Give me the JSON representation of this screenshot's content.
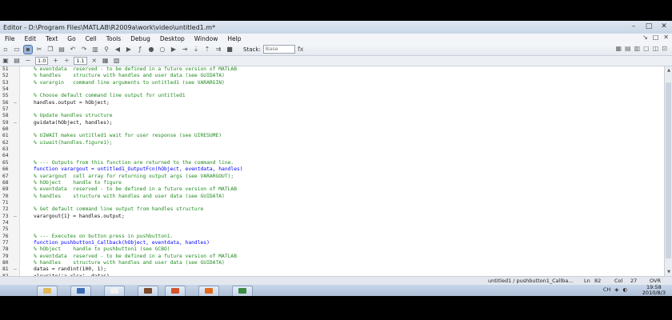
{
  "window": {
    "title": "Editor - D:\\Program Files\\MATLAB\\R2009a\\work\\video\\untitled1.m*",
    "minimize": "–",
    "maximize": "□",
    "close": "✕"
  },
  "menu": {
    "items": [
      "File",
      "Edit",
      "Text",
      "Go",
      "Cell",
      "Tools",
      "Debug",
      "Desktop",
      "Window",
      "Help"
    ],
    "right_controls": [
      "↘",
      "□",
      "✕"
    ]
  },
  "toolbar": {
    "stack_label": "Stack:",
    "stack_value": "Base",
    "fx_label": "fx"
  },
  "cell_toolbar": {
    "minus": "−",
    "value1": "1.0",
    "plus": "+",
    "divide": "÷",
    "value2": "1.1",
    "times": "×"
  },
  "editor": {
    "lines": [
      {
        "n": "51",
        "fold": "",
        "type": "comment",
        "text": "% eventdata  reserved - to be defined in a future version of MATLAB"
      },
      {
        "n": "52",
        "fold": "",
        "type": "comment",
        "text": "% handles    structure with handles and user data (see GUIDATA)"
      },
      {
        "n": "53",
        "fold": "",
        "type": "comment",
        "text": "% varargin   command line arguments to untitled1 (see VARARGIN)"
      },
      {
        "n": "54",
        "fold": "",
        "type": "",
        "text": ""
      },
      {
        "n": "55",
        "fold": "",
        "type": "comment",
        "text": "% Choose default command line output for untitled1"
      },
      {
        "n": "56",
        "fold": "–",
        "type": "",
        "text": "handles.output = hObject;"
      },
      {
        "n": "57",
        "fold": "",
        "type": "",
        "text": ""
      },
      {
        "n": "58",
        "fold": "",
        "type": "comment",
        "text": "% Update handles structure"
      },
      {
        "n": "59",
        "fold": "–",
        "type": "",
        "text": "guidata(hObject, handles);"
      },
      {
        "n": "60",
        "fold": "",
        "type": "",
        "text": ""
      },
      {
        "n": "61",
        "fold": "",
        "type": "comment",
        "text": "% UIWAIT makes untitled1 wait for user response (see UIRESUME)"
      },
      {
        "n": "62",
        "fold": "",
        "type": "comment",
        "text": "% uiwait(handles.figure1);"
      },
      {
        "n": "63",
        "fold": "",
        "type": "",
        "text": ""
      },
      {
        "n": "64",
        "fold": "",
        "type": "",
        "text": ""
      },
      {
        "n": "65",
        "fold": "",
        "type": "comment",
        "text": "% --- Outputs from this function are returned to the command line."
      },
      {
        "n": "66",
        "fold": "",
        "type": "keyword",
        "text": "function varargout = untitled1_OutputFcn(hObject, eventdata, handles)"
      },
      {
        "n": "67",
        "fold": "",
        "type": "comment",
        "text": "% varargout  cell array for returning output args (see VARARGOUT);"
      },
      {
        "n": "68",
        "fold": "",
        "type": "comment",
        "text": "% hObject    handle to figure"
      },
      {
        "n": "69",
        "fold": "",
        "type": "comment",
        "text": "% eventdata  reserved - to be defined in a future version of MATLAB"
      },
      {
        "n": "70",
        "fold": "",
        "type": "comment",
        "text": "% handles    structure with handles and user data (see GUIDATA)"
      },
      {
        "n": "71",
        "fold": "",
        "type": "",
        "text": ""
      },
      {
        "n": "72",
        "fold": "",
        "type": "comment",
        "text": "% Get default command line output from handles structure"
      },
      {
        "n": "73",
        "fold": "–",
        "type": "",
        "text": "varargout{1} = handles.output;"
      },
      {
        "n": "74",
        "fold": "",
        "type": "",
        "text": ""
      },
      {
        "n": "75",
        "fold": "",
        "type": "",
        "text": ""
      },
      {
        "n": "76",
        "fold": "",
        "type": "comment",
        "text": "% --- Executes on button press in pushbutton1."
      },
      {
        "n": "77",
        "fold": "",
        "type": "keyword",
        "text": "function pushbutton1_Callback(hObject, eventdata, handles)"
      },
      {
        "n": "78",
        "fold": "",
        "type": "comment",
        "text": "% hObject    handle to pushbutton1 (see GCBO)"
      },
      {
        "n": "79",
        "fold": "",
        "type": "comment",
        "text": "% eventdata  reserved - to be defined in a future version of MATLAB"
      },
      {
        "n": "80",
        "fold": "",
        "type": "comment",
        "text": "% handles    structure with handles and user data (see GUIDATA)"
      },
      {
        "n": "81",
        "fold": "–",
        "type": "",
        "text": "datas = randint(100, 1);"
      },
      {
        "n": "82",
        "fold": "–",
        "type": "",
        "text": "xlswrite('a.xlsx', datas)"
      }
    ]
  },
  "status": {
    "function_name": "untitled1 / pushbutton1_Callba...",
    "ln_label": "Ln",
    "ln_value": "82",
    "col_label": "Col",
    "col_value": "27",
    "ovr": "OVR"
  },
  "taskbar": {
    "lang": "CH",
    "time": "19:58",
    "date": "2010/8/3"
  }
}
